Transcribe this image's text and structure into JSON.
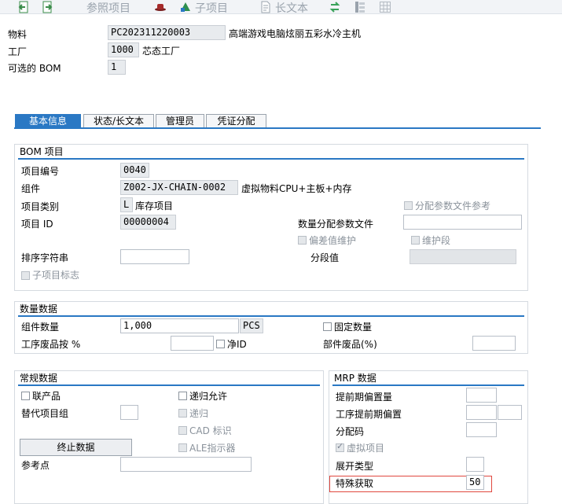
{
  "toolbar": {
    "items": [
      {
        "icon": "back-arrow-icon"
      },
      {
        "icon": "forward-arrow-icon"
      },
      {
        "label": "参照项目"
      },
      {
        "icon": "hat-icon"
      },
      {
        "icon": "tree-icon",
        "label": "子项目"
      },
      {
        "icon": "document-icon",
        "label": "长文本"
      },
      {
        "icon": "refresh-icon"
      },
      {
        "icon": "structure-icon"
      },
      {
        "icon": "grid-icon"
      }
    ]
  },
  "header": {
    "material_label": "物料",
    "material_value": "PC202311220003",
    "material_desc": "高端游戏电脑炫丽五彩水冷主机",
    "plant_label": "工厂",
    "plant_value": "1000",
    "plant_desc": "芯态工厂",
    "alt_bom_label": "可选的 BOM",
    "alt_bom_value": "1"
  },
  "tabs": [
    {
      "label": "基本信息",
      "active": true
    },
    {
      "label": "状态/长文本",
      "active": false
    },
    {
      "label": "管理员",
      "active": false
    },
    {
      "label": "凭证分配",
      "active": false
    }
  ],
  "bom_item": {
    "title": "BOM 项目",
    "item_no_label": "项目编号",
    "item_no_value": "0040",
    "component_label": "组件",
    "component_value": "Z002-JX-CHAIN-0002",
    "component_desc": "虚拟物料CPU+主板+内存",
    "item_cat_label": "项目类别",
    "item_cat_value": "L",
    "item_cat_desc": "库存项目",
    "item_id_label": "项目 ID",
    "item_id_value": "00000004",
    "sort_label": "排序字符串",
    "sort_value": "",
    "sub_item_label": "子项目标志",
    "class_ref_label": "分配参数文件参考",
    "qty_profile_label": "数量分配参数文件",
    "qty_profile_value": "",
    "deviation_label": "偏差值维护",
    "maint_label": "维护段",
    "section_label": "分段值",
    "section_value": ""
  },
  "qty_data": {
    "title": "数量数据",
    "comp_qty_label": "组件数量",
    "comp_qty_value": "1,000",
    "unit_value": "PCS",
    "fixed_qty_label": "固定数量",
    "op_scrap_label": "工序废品按 %",
    "op_scrap_value": "",
    "net_id_label": "净ID",
    "comp_scrap_label": "部件废品(%)",
    "comp_scrap_value": ""
  },
  "general": {
    "title": "常规数据",
    "coproduct_label": "联产品",
    "recursive_label": "递归允许",
    "alt_group_label": "替代项目组",
    "alt_group_value": "",
    "recursion_label": "递归",
    "cad_label": "CAD 标识",
    "ale_label": "ALE指示器",
    "end_data_button": "终止数据",
    "ref_point_label": "参考点",
    "ref_point_value": ""
  },
  "mrp": {
    "title": "MRP 数据",
    "lead_offset_label": "提前期偏置量",
    "lead_offset_value": "",
    "op_lead_label": "工序提前期偏置",
    "op_lead_value": "",
    "op_lead_value2": "",
    "dist_key_label": "分配码",
    "dist_key_value": "",
    "phantom_label": "虚拟项目",
    "explosion_label": "展开类型",
    "explosion_value": "",
    "special_label": "特殊获取",
    "special_value": "50"
  },
  "colors": {
    "accent": "#2a78c4",
    "highlight_border": "#e0483f"
  }
}
